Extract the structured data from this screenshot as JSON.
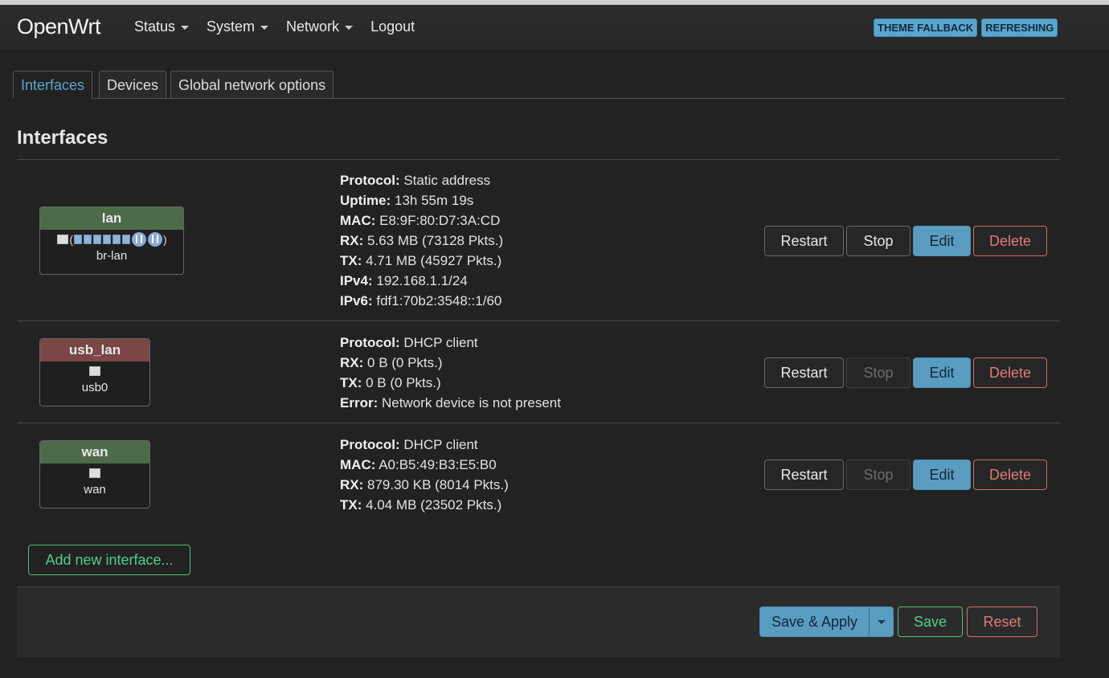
{
  "brand": "OpenWrt",
  "menu": [
    {
      "label": "Status",
      "has_caret": true
    },
    {
      "label": "System",
      "has_caret": true
    },
    {
      "label": "Network",
      "has_caret": true
    },
    {
      "label": "Logout",
      "has_caret": false
    }
  ],
  "badges": [
    "THEME FALLBACK",
    "REFRESHING"
  ],
  "tabs": [
    "Interfaces",
    "Devices",
    "Global network options"
  ],
  "active_tab": "Interfaces",
  "section_title": "Interfaces",
  "interfaces": [
    {
      "name": "lan",
      "status_color": "green",
      "icons_text": "(",
      "icons_text_end": ")",
      "device": "br-lan",
      "details": [
        {
          "label": "Protocol:",
          "value": "Static address"
        },
        {
          "label": "Uptime:",
          "value": "13h 55m 19s"
        },
        {
          "label": "MAC:",
          "value": "E8:9F:80:D7:3A:CD"
        },
        {
          "label": "RX:",
          "value": "5.63 MB (73128 Pkts.)"
        },
        {
          "label": "TX:",
          "value": "4.71 MB (45927 Pkts.)"
        },
        {
          "label": "IPv4:",
          "value": "192.168.1.1/24"
        },
        {
          "label": "IPv6:",
          "value": "fdf1:70b2:3548::1/60"
        }
      ],
      "stop_disabled": false
    },
    {
      "name": "usb_lan",
      "status_color": "red",
      "device": "usb0",
      "details": [
        {
          "label": "Protocol:",
          "value": "DHCP client"
        },
        {
          "label": "RX:",
          "value": "0 B (0 Pkts.)"
        },
        {
          "label": "TX:",
          "value": "0 B (0 Pkts.)"
        },
        {
          "label": "Error:",
          "value": "Network device is not present"
        }
      ],
      "stop_disabled": true
    },
    {
      "name": "wan",
      "status_color": "green",
      "device": "wan",
      "details": [
        {
          "label": "Protocol:",
          "value": "DHCP client"
        },
        {
          "label": "MAC:",
          "value": "A0:B5:49:B3:E5:B0"
        },
        {
          "label": "RX:",
          "value": "879.30 KB (8014 Pkts.)"
        },
        {
          "label": "TX:",
          "value": "4.04 MB (23502 Pkts.)"
        }
      ],
      "stop_disabled": true
    }
  ],
  "row_buttons": {
    "restart": "Restart",
    "stop": "Stop",
    "edit": "Edit",
    "delete": "Delete"
  },
  "add_interface_label": "Add new interface...",
  "footer": {
    "save_apply": "Save & Apply",
    "save": "Save",
    "reset": "Reset"
  },
  "colors": {
    "accent": "#5aa5cd",
    "positive": "#4fcf86",
    "negative": "#e07b7b",
    "status_up": "#4c6b4a",
    "status_down": "#7a4646"
  }
}
